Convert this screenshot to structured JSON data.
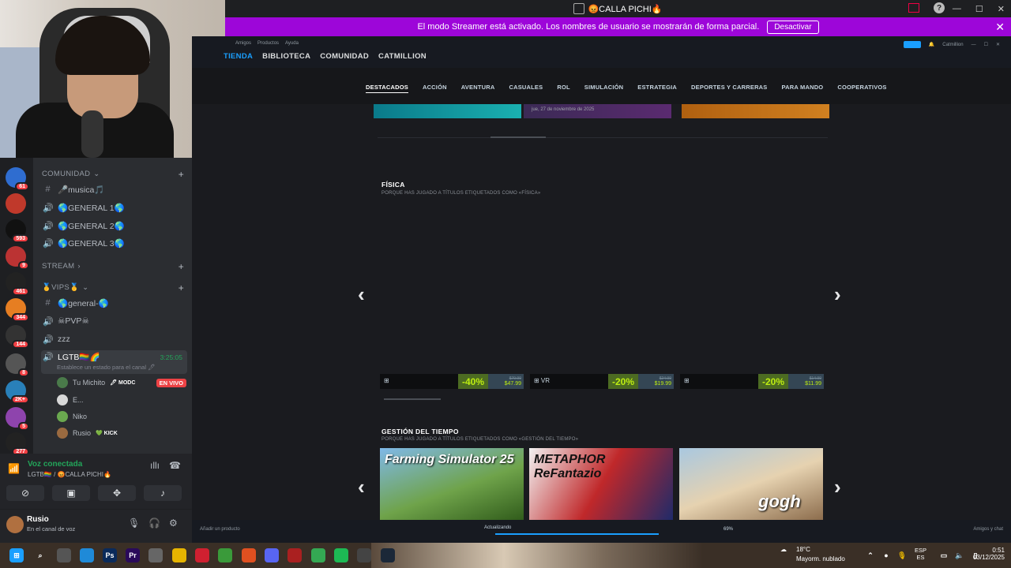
{
  "window": {
    "title": "😡CALLA PICHI🔥"
  },
  "banner": {
    "text": "El modo Streamer está activado. Los nombres de usuario se mostrarán de forma parcial.",
    "button": "Desactivar",
    "close": "✕"
  },
  "discord": {
    "servers": [
      {
        "badge": "61",
        "color": "#2f6dd0"
      },
      {
        "badge": "",
        "color": "#c0392b"
      },
      {
        "badge": "593",
        "color": "#111111"
      },
      {
        "badge": "9",
        "color": "#b33"
      },
      {
        "badge": "461",
        "color": "#222"
      },
      {
        "badge": "344",
        "color": "#e67e22"
      },
      {
        "badge": "144",
        "color": "#333"
      },
      {
        "badge": "8",
        "color": "#555"
      },
      {
        "badge": "2K+",
        "color": "#2980b9"
      },
      {
        "badge": "5",
        "color": "#8e44ad"
      },
      {
        "badge": "277",
        "color": "#222"
      }
    ],
    "category_comunidad": "COMUNIDAD",
    "channels_comunidad": [
      {
        "sym": "#",
        "name": "🎤musica🎵"
      },
      {
        "sym": "🔊",
        "name": "🌎GENERAL 1🌎"
      },
      {
        "sym": "🔊",
        "name": "🌎GENERAL 2🌎"
      },
      {
        "sym": "🔊",
        "name": "🌎GENERAL 3🌎"
      }
    ],
    "category_stream": "STREAM",
    "category_vips": "🥇VIPS🥇",
    "channels_vips": [
      {
        "sym": "#",
        "name": "🌎general-🌎"
      },
      {
        "sym": "🔊",
        "name": "☠PVP☠"
      },
      {
        "sym": "🔊",
        "name": "zzz"
      }
    ],
    "active_channel": {
      "name": "LGTB🏳️‍🌈🌈",
      "timer": "3:25:05",
      "sub": "Establece un estado para el canal 🖊"
    },
    "voice_users": [
      {
        "name": "Tu Michito",
        "tag": "🖊 MODC",
        "live": "EN VIVO",
        "color": "#4a7a4a"
      },
      {
        "name": "E...",
        "tag": "",
        "live": "",
        "color": "#d8d8d8"
      },
      {
        "name": "Niko",
        "tag": "",
        "live": "",
        "color": "#6aa84f"
      },
      {
        "name": "Rusio",
        "tag": "💚 KICK",
        "live": "",
        "color": "#9a6a40"
      }
    ],
    "voice_status": "Voz conectada",
    "voice_channel": "LGTB🏳️‍🌈 / 😡CALLA PICHI🔥",
    "user_name": "Rusio",
    "user_status": "En el canal de voz"
  },
  "steam": {
    "mininav": [
      "Amigos",
      "Productos",
      "Ayuda"
    ],
    "mainnav": [
      "TIENDA",
      "BIBLIOTECA",
      "COMUNIDAD",
      "CATMILLION"
    ],
    "account": "Catmillion",
    "categories": [
      "DESTACADOS",
      "ACCIÓN",
      "AVENTURA",
      "CASUALES",
      "ROL",
      "SIMULACIÓN",
      "ESTRATEGIA",
      "DEPORTES Y CARRERAS",
      "PARA MANDO",
      "COOPERATIVOS"
    ],
    "strip_date": "jue, 27 de noviembre de 2025",
    "section1_title": "FÍSICA",
    "section1_sub": "PORQUE HAS JUGADO A TÍTULOS ETIQUETADOS COMO «FÍSICA»",
    "prices": [
      {
        "platform": "⊞",
        "discount": "-40%",
        "old": "$79.99",
        "new": "$47.99"
      },
      {
        "platform": "⊞ VR",
        "discount": "-20%",
        "old": "$24.99",
        "new": "$19.99"
      },
      {
        "platform": "⊞",
        "discount": "-20%",
        "old": "$14.99",
        "new": "$11.99"
      }
    ],
    "section2_title": "GESTIÓN DEL TIEMPO",
    "section2_sub": "PORQUE HAS JUGADO A TÍTULOS ETIQUETADOS COMO «GESTIÓN DEL TIEMPO»",
    "tiles": [
      {
        "label": "Farming Simulator 25"
      },
      {
        "label": "METAPHOR ReFantazio"
      },
      {
        "label": "gogh"
      }
    ],
    "add_game": "Añadir un producto",
    "download_label": "Actualizando",
    "download_pct": "69%",
    "download_progress": 0.69,
    "friends": "Amigos y chat"
  },
  "taskbar": {
    "temp": "18°C",
    "weather": "Mayorm. nublado",
    "lang": "ESP",
    "lang2": "ES",
    "time": "0:51",
    "date": "03/12/2025"
  }
}
